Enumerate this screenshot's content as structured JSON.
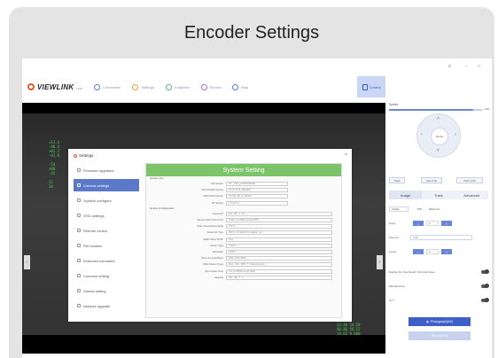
{
  "banner": {
    "title": "Encoder Settings"
  },
  "app": {
    "logo_text": "VIEWLINK",
    "logo_sub": "Y.100",
    "nav": [
      {
        "label": "Connection",
        "icon": "connection-icon"
      },
      {
        "label": "Settings",
        "icon": "gear-icon"
      },
      {
        "label": "Snapshot",
        "icon": "snapshot-icon"
      },
      {
        "label": "Record",
        "icon": "record-icon"
      },
      {
        "label": "Map",
        "icon": "map-icon"
      }
    ],
    "nav_active": {
      "label": "Control",
      "icon": "control-icon"
    },
    "window_controls": {
      "minimize": "–",
      "maximize": "□"
    }
  },
  "dialog": {
    "title": "Settings",
    "close": "×",
    "menu": [
      {
        "label": "Firmware upgrades"
      },
      {
        "label": "Camera settings"
      },
      {
        "label": "Joystick configure"
      },
      {
        "label": "OSD settings"
      },
      {
        "label": "Remote control"
      },
      {
        "label": "File location"
      },
      {
        "label": "Extended command"
      },
      {
        "label": "Common setting"
      },
      {
        "label": "Gimbal setting"
      },
      {
        "label": "Network upgrade"
      }
    ],
    "panel": {
      "header": "System Setting",
      "section1": "System info",
      "info_rows": [
        {
          "label": "Soft Version",
          "value": "CPT_V36.5_20220818(RIS8)"
        },
        {
          "label": "FPGA Model Version",
          "value": "V8.12.G4.V6_20220816"
        },
        {
          "label": "DSP Model Version",
          "value": "V2.3.05_SIF_F4_202206"
        },
        {
          "label": "RF Version",
          "value": "V2.1.2A.1.2"
        }
      ],
      "section2": "Device Configuration",
      "config_rows": [
        {
          "label": "Camera IP",
          "value": "192 . 168 . 2 . 119"
        },
        {
          "label": "Camera UDP Control Port",
          "value": "37260  ▾  (1~65535 as Light 2500)"
        },
        {
          "label": "Video Transmission Mode",
          "value": "TCP ▾"
        },
        {
          "label": "Serial Port Type",
          "value": "RPI1 ▾ ( ZY Model Not Available, etc.)"
        },
        {
          "label": "HDMI Output RTSP",
          "value": "ON ▾"
        },
        {
          "label": "Stream Type",
          "value": "H.265 ▾"
        },
        {
          "label": "Resolution",
          "value": "1080P ▾"
        },
        {
          "label": "Stop Link Link Bitrate",
          "value": "4096  ( 1000~9000 )"
        },
        {
          "label": "Video Stream Types",
          "value": "Pass · TCP · RIPS · T.T Pass Encryption"
        },
        {
          "label": "Stop Stream Pixel",
          "value": "70  ▾  (1~65535 as Light 2500)"
        },
        {
          "label": "Gateway",
          "value": "192 . 168 . 2 . 1"
        }
      ]
    }
  },
  "control_panel": {
    "speed_label": "Speed",
    "speed_value": "100",
    "speed_fraction": 0.9,
    "home_label": "Home",
    "btn_track": "Track",
    "btn_yaw": "Yaw 0.00",
    "btn_pitch": "Pitch 0.00",
    "tabs": [
      "Image",
      "Track",
      "Advanced"
    ],
    "active_tab": "Image",
    "fields": {
      "visible_label": "Visible",
      "pip_label": "PIP",
      "white_hot": "White hot",
      "zoom_label": "Zoom",
      "zoom_to": "Zoom to",
      "zoom_value": "1.00",
      "focus_label": "Focus"
    },
    "toggles": [
      {
        "label": "Display the Yaw Return Grid tract layer"
      },
      {
        "label": "Manual focus"
      },
      {
        "label": "AI / I"
      }
    ],
    "photo_button": "Photograph(0/0)",
    "record_button": "Record(0/0)"
  }
}
